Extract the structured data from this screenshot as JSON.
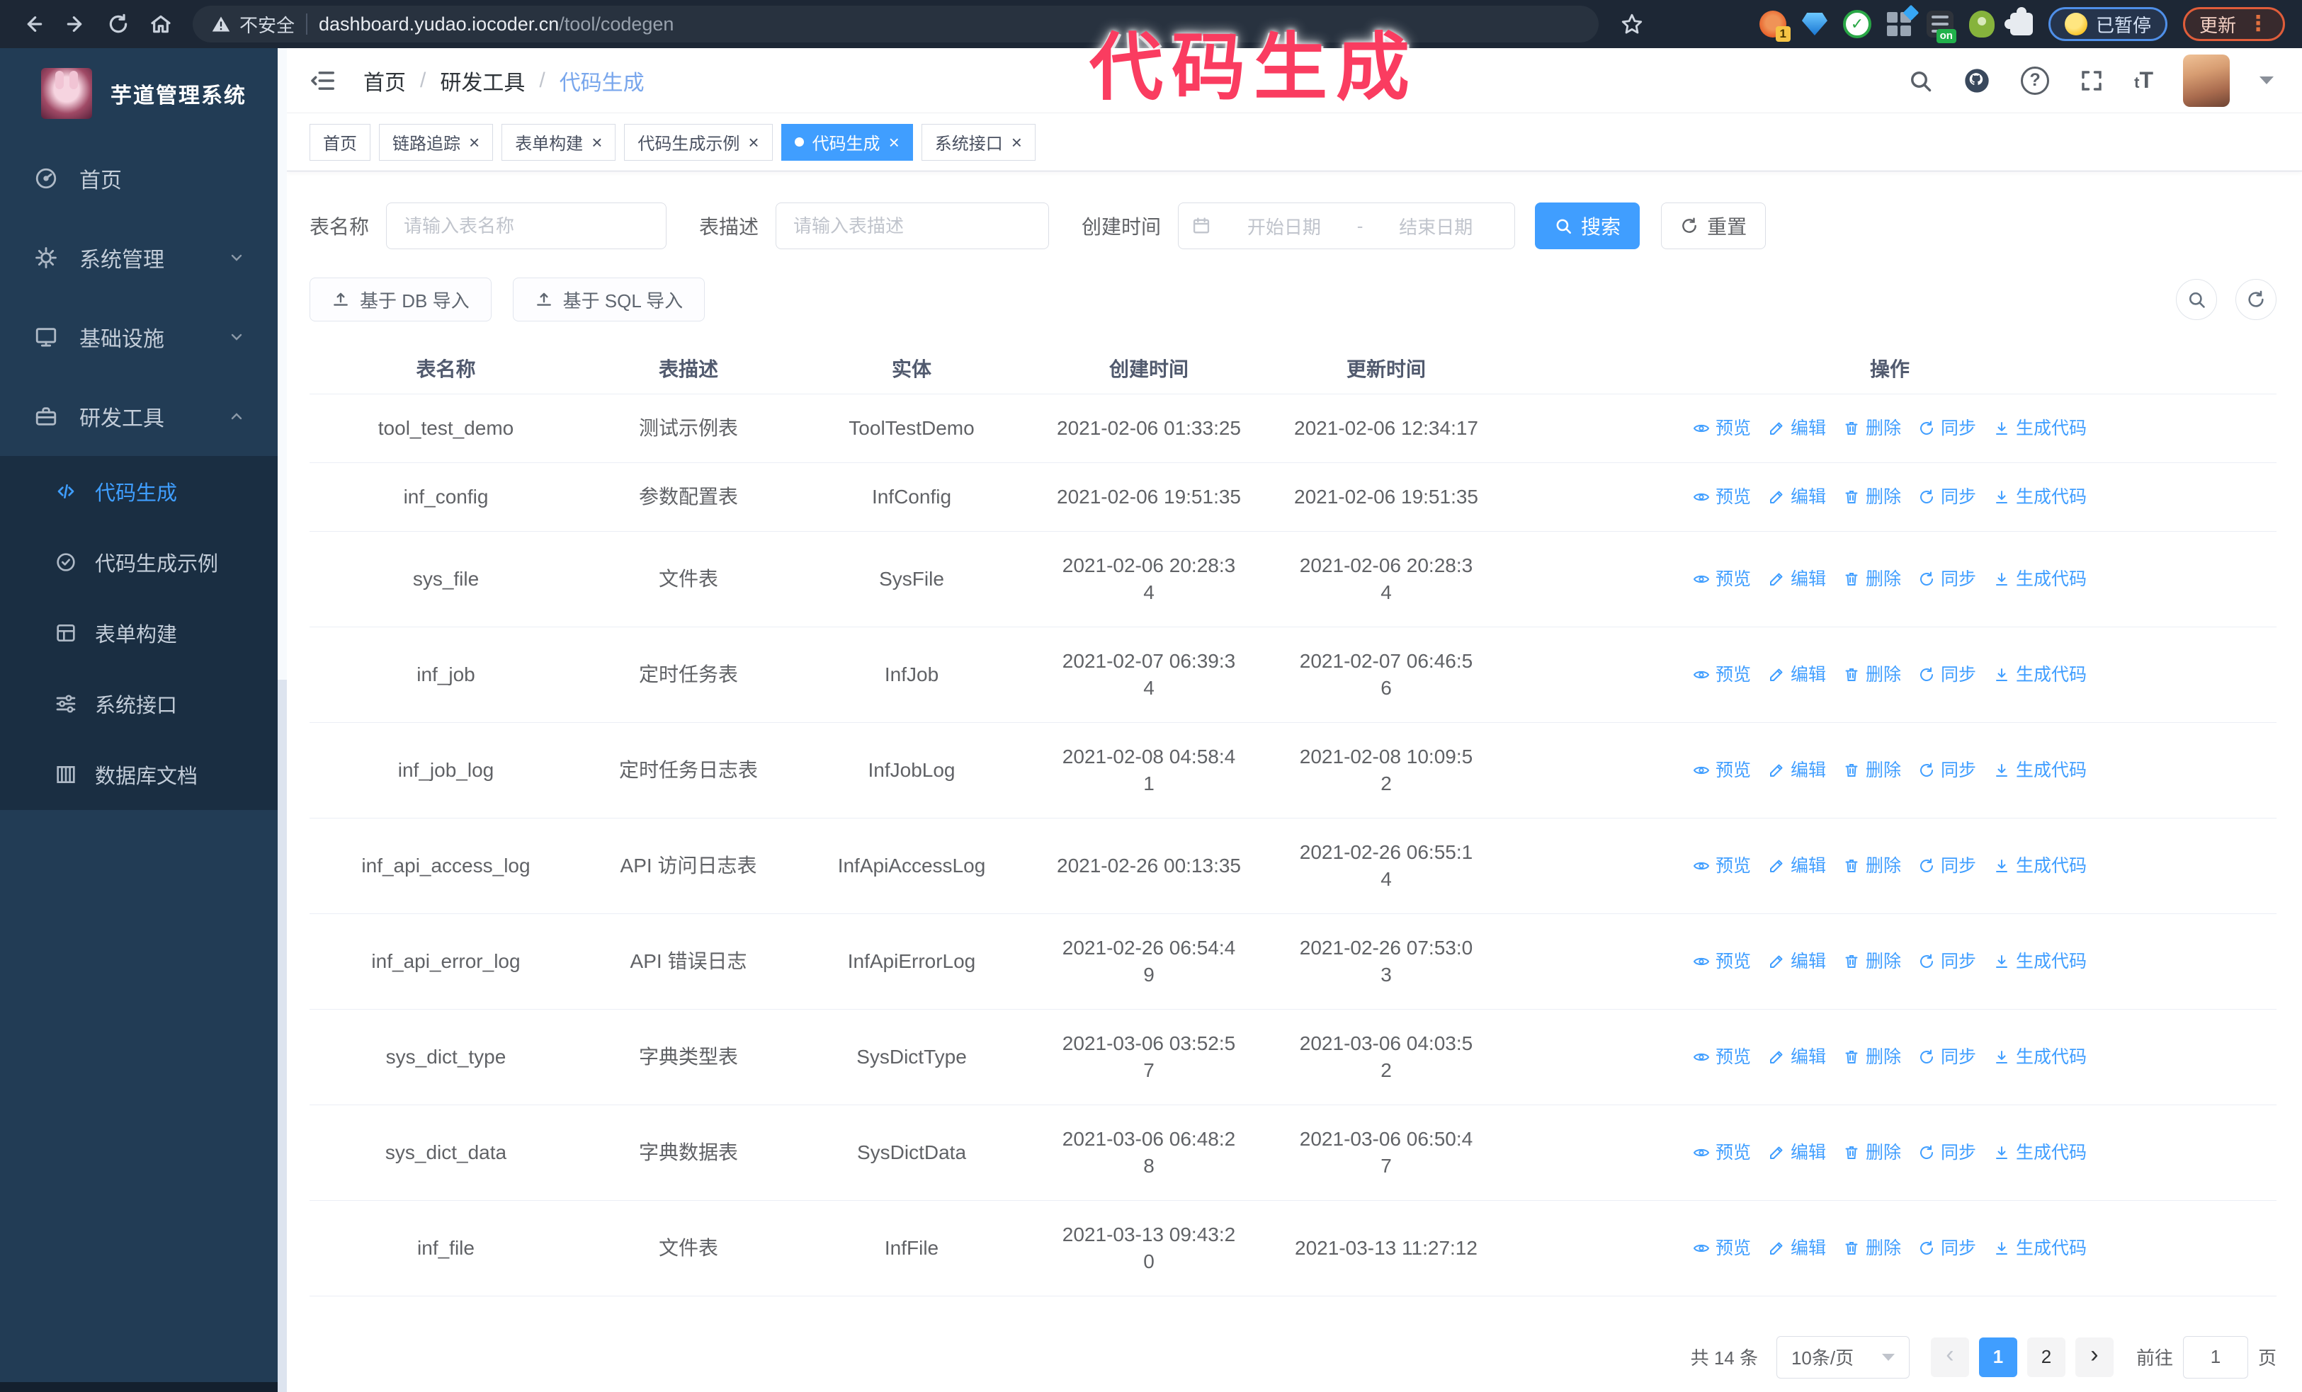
{
  "browser": {
    "security_label": "不安全",
    "url_host": "dashboard.yudao.iocoder.cn",
    "url_path": "/tool/codegen",
    "extension_badge": "1",
    "extension_on_badge": "on",
    "paused_badge": "已暂停",
    "update_badge": "更新"
  },
  "annotation": {
    "text": "代码生成",
    "color": "#fa3c60"
  },
  "sidebar": {
    "title": "芋道管理系统",
    "items": [
      {
        "label": "首页"
      },
      {
        "label": "系统管理"
      },
      {
        "label": "基础设施"
      },
      {
        "label": "研发工具"
      }
    ],
    "submenu": [
      {
        "label": "代码生成"
      },
      {
        "label": "代码生成示例"
      },
      {
        "label": "表单构建"
      },
      {
        "label": "系统接口"
      },
      {
        "label": "数据库文档"
      }
    ]
  },
  "header": {
    "breadcrumb": [
      "首页",
      "研发工具",
      "代码生成"
    ]
  },
  "tabs": [
    {
      "label": "首页",
      "closable": false,
      "active": false
    },
    {
      "label": "链路追踪",
      "closable": true,
      "active": false
    },
    {
      "label": "表单构建",
      "closable": true,
      "active": false
    },
    {
      "label": "代码生成示例",
      "closable": true,
      "active": false
    },
    {
      "label": "代码生成",
      "closable": true,
      "active": true
    },
    {
      "label": "系统接口",
      "closable": true,
      "active": false
    }
  ],
  "filters": {
    "table_name_label": "表名称",
    "table_name_placeholder": "请输入表名称",
    "table_desc_label": "表描述",
    "table_desc_placeholder": "请输入表描述",
    "create_time_label": "创建时间",
    "date_start_placeholder": "开始日期",
    "date_separator": "-",
    "date_end_placeholder": "结束日期",
    "search_label": "搜索",
    "reset_label": "重置"
  },
  "toolbar": {
    "import_db_label": "基于 DB 导入",
    "import_sql_label": "基于 SQL 导入"
  },
  "table": {
    "columns": [
      "表名称",
      "表描述",
      "实体",
      "创建时间",
      "更新时间",
      "操作"
    ],
    "actions": [
      "预览",
      "编辑",
      "删除",
      "同步",
      "生成代码"
    ],
    "rows": [
      {
        "name": "tool_test_demo",
        "desc": "测试示例表",
        "entity": "ToolTestDemo",
        "created": "2021-02-06 01:33:25",
        "updated": "2021-02-06 12:34:17"
      },
      {
        "name": "inf_config",
        "desc": "参数配置表",
        "entity": "InfConfig",
        "created": "2021-02-06 19:51:35",
        "updated": "2021-02-06 19:51:35"
      },
      {
        "name": "sys_file",
        "desc": "文件表",
        "entity": "SysFile",
        "created": "2021-02-06 20:28:3\n4",
        "updated": "2021-02-06 20:28:3\n4"
      },
      {
        "name": "inf_job",
        "desc": "定时任务表",
        "entity": "InfJob",
        "created": "2021-02-07 06:39:3\n4",
        "updated": "2021-02-07 06:46:5\n6"
      },
      {
        "name": "inf_job_log",
        "desc": "定时任务日志表",
        "entity": "InfJobLog",
        "created": "2021-02-08 04:58:4\n1",
        "updated": "2021-02-08 10:09:5\n2"
      },
      {
        "name": "inf_api_access_log",
        "desc": "API 访问日志表",
        "entity": "InfApiAccessLog",
        "created": "2021-02-26 00:13:35",
        "updated": "2021-02-26 06:55:1\n4"
      },
      {
        "name": "inf_api_error_log",
        "desc": "API 错误日志",
        "entity": "InfApiErrorLog",
        "created": "2021-02-26 06:54:4\n9",
        "updated": "2021-02-26 07:53:0\n3"
      },
      {
        "name": "sys_dict_type",
        "desc": "字典类型表",
        "entity": "SysDictType",
        "created": "2021-03-06 03:52:5\n7",
        "updated": "2021-03-06 04:03:5\n2"
      },
      {
        "name": "sys_dict_data",
        "desc": "字典数据表",
        "entity": "SysDictData",
        "created": "2021-03-06 06:48:2\n8",
        "updated": "2021-03-06 06:50:4\n7"
      },
      {
        "name": "inf_file",
        "desc": "文件表",
        "entity": "InfFile",
        "created": "2021-03-13 09:43:2\n0",
        "updated": "2021-03-13 11:27:12"
      }
    ]
  },
  "pagination": {
    "total_label": "共 14 条",
    "page_size": "10条/页",
    "prev_glyph": "‹",
    "next_glyph": "›",
    "pages": [
      "1",
      "2"
    ],
    "goto_label": "前往",
    "goto_value": "1",
    "page_suffix": "页"
  },
  "colors": {
    "accent": "#409EFF",
    "annotation": "#fa3c60",
    "sidebar_bg": "#223c55",
    "submenu_bg": "#1a2e42"
  }
}
